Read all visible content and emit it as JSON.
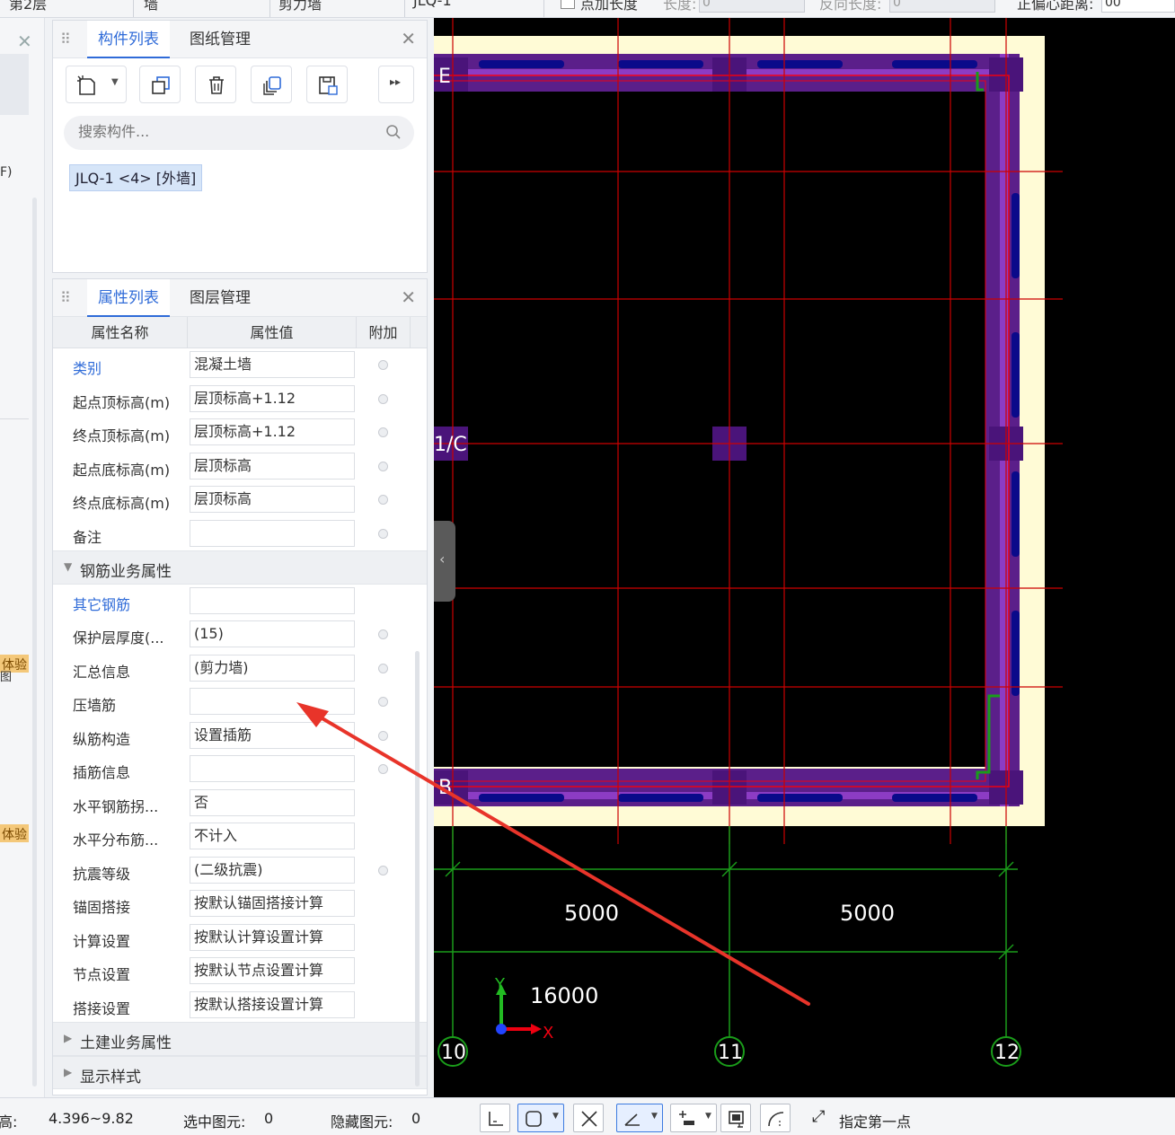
{
  "topbar": {
    "floor": "第2层",
    "category": "墙",
    "type": "剪力墙",
    "component": "JLQ-1",
    "add_length_label": "点加长度",
    "length_label": "长度:",
    "length_value": "0",
    "reverse_length_label": "反向长度:",
    "reverse_length_value": "0",
    "offset_label": "正偏心距离:",
    "offset_value": "00"
  },
  "left_strip": {
    "partial_text": "F)",
    "badge1": "体验",
    "badge1_sub": "图",
    "badge2": "体验"
  },
  "component_panel": {
    "tab_components": "构件列表",
    "tab_drawings": "图纸管理",
    "search_placeholder": "搜索构件...",
    "selected_item": "JLQ-1 <4> [外墙]"
  },
  "property_panel": {
    "tab_properties": "属性列表",
    "tab_layers": "图层管理",
    "col_name": "属性名称",
    "col_value": "属性值",
    "col_extra": "附加",
    "rows": [
      {
        "name": "类别",
        "value": "混凝土墙"
      },
      {
        "name": "起点顶标高(m)",
        "value": "层顶标高+1.12"
      },
      {
        "name": "终点顶标高(m)",
        "value": "层顶标高+1.12"
      },
      {
        "name": "起点底标高(m)",
        "value": "层顶标高"
      },
      {
        "name": "终点底标高(m)",
        "value": "层顶标高"
      },
      {
        "name": "备注",
        "value": ""
      }
    ],
    "group_rebar": "钢筋业务属性",
    "rebar_rows": [
      {
        "name": "其它钢筋",
        "value": ""
      },
      {
        "name": "保护层厚度(...",
        "value": "(15)"
      },
      {
        "name": "汇总信息",
        "value": "(剪力墙)"
      },
      {
        "name": "压墙筋",
        "value": ""
      },
      {
        "name": "纵筋构造",
        "value": "设置插筋"
      },
      {
        "name": "插筋信息",
        "value": ""
      },
      {
        "name": "水平钢筋拐...",
        "value": "否"
      },
      {
        "name": "水平分布筋...",
        "value": "不计入"
      },
      {
        "name": "抗震等级",
        "value": "(二级抗震)"
      },
      {
        "name": "锚固搭接",
        "value": "按默认锚固搭接计算"
      },
      {
        "name": "计算设置",
        "value": "按默认计算设置计算"
      },
      {
        "name": "节点设置",
        "value": "按默认节点设置计算"
      },
      {
        "name": "搭接设置",
        "value": "按默认搭接设置计算"
      }
    ],
    "group_civil": "土建业务属性",
    "group_display": "显示样式"
  },
  "canvas": {
    "axis_E": "E",
    "axis_1C": "1/C",
    "axis_B": "B",
    "axis_10": "10",
    "axis_11": "11",
    "axis_12": "12",
    "dim1": "5000",
    "dim2": "5000",
    "dim_total": "16000",
    "axis_y": "Y",
    "axis_x": "X",
    "colors": {
      "wall": "#5b1f8a",
      "slab": "#fffbd6",
      "grid": "#d11",
      "dim": "#1a9c1a",
      "rebar": "#0a0a8a"
    }
  },
  "status": {
    "elevation_label": "标高:",
    "elevation_value": "4.396~9.82",
    "selected_label": "选中图元:",
    "selected_value": "0",
    "hidden_label": "隐藏图元:",
    "hidden_value": "0",
    "prompt": "指定第一点"
  }
}
